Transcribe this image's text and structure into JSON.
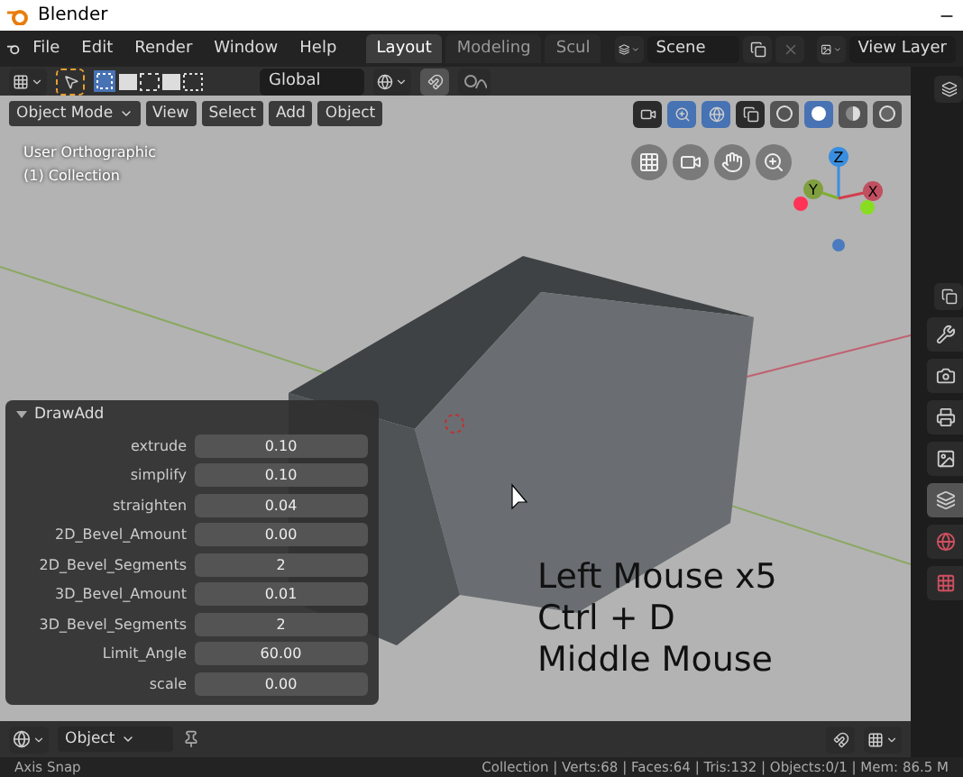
{
  "window": {
    "title": "Blender"
  },
  "menu": [
    "File",
    "Edit",
    "Render",
    "Window",
    "Help"
  ],
  "workspaces": [
    {
      "label": "Layout",
      "selected": true
    },
    {
      "label": "Modeling",
      "selected": false
    },
    {
      "label": "Scul",
      "selected": false
    }
  ],
  "scene": "Scene",
  "view_layer": "View Layer",
  "tool_header": {
    "orientation": "Global"
  },
  "viewport_header": {
    "mode": "Object Mode",
    "menus": [
      "View",
      "Select",
      "Add",
      "Object"
    ],
    "shading": [
      {
        "kind": "wireframe",
        "selected": false
      },
      {
        "kind": "solid",
        "selected": true
      },
      {
        "kind": "material",
        "selected": false
      },
      {
        "kind": "rendered",
        "selected": false
      }
    ]
  },
  "viewport": {
    "view_name": "User Orthographic",
    "collection": "(1) Collection",
    "axes": [
      "X",
      "Y",
      "Z"
    ]
  },
  "operator_panel": {
    "title": "DrawAdd",
    "expanded": true,
    "fields": [
      {
        "label": "extrude",
        "value": "0.10"
      },
      {
        "label": "simplify",
        "value": "0.10"
      },
      {
        "label": "straighten",
        "value": "0.04"
      },
      {
        "label": "2D_Bevel_Amount",
        "value": "0.00"
      },
      {
        "label": "2D_Bevel_Segments",
        "value": "2"
      },
      {
        "label": "3D_Bevel_Amount",
        "value": "0.01"
      },
      {
        "label": "3D_Bevel_Segments",
        "value": "2"
      },
      {
        "label": "Limit_Angle",
        "value": "60.00"
      },
      {
        "label": "scale",
        "value": "0.00"
      }
    ]
  },
  "keys": [
    "Left Mouse x5",
    "Ctrl + D",
    "Middle Mouse"
  ],
  "properties_tabs": [
    {
      "kind": "tool",
      "selected": false
    },
    {
      "kind": "render",
      "selected": false
    },
    {
      "kind": "output",
      "selected": false
    },
    {
      "kind": "view_layer",
      "selected": false
    },
    {
      "kind": "scene",
      "selected": true
    },
    {
      "kind": "world",
      "selected": false
    },
    {
      "kind": "texture",
      "selected": false
    }
  ],
  "bottom_header": {
    "mode": "Object"
  },
  "status_bar": {
    "left": "Axis Snap",
    "right": "Collection | Verts:68 | Faces:64 | Tris:132 | Objects:0/1 | Mem: 86.5 M"
  }
}
